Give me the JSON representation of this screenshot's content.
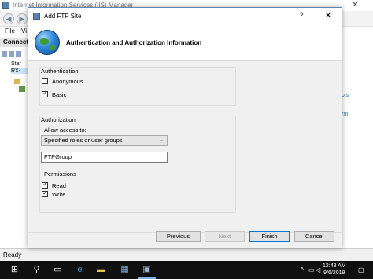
{
  "iis": {
    "title": "Internet Information Services (IIS) Manager",
    "menu": {
      "file": "File",
      "view": "Vi"
    },
    "connections_header": "Connection",
    "tree": {
      "start": "Star",
      "server": "RX-"
    },
    "right_links": {
      "tools": "ols",
      "rm": "rm"
    },
    "status": "Ready",
    "close": "✕"
  },
  "dialog": {
    "title": "Add FTP Site",
    "help": "?",
    "close": "✕",
    "heading": "Authentication and Authorization Information",
    "authentication": {
      "label": "Authentication",
      "anonymous": {
        "label": "Anonymous",
        "checked": false
      },
      "basic": {
        "label": "Basic",
        "checked": true
      }
    },
    "authorization": {
      "label": "Authorization",
      "allow_label": "Allow access to:",
      "allow_value": "Specified roles or user groups",
      "group_value": "FTPGroup",
      "permissions_label": "Permissions",
      "read": {
        "label": "Read",
        "checked": true
      },
      "write": {
        "label": "Write",
        "checked": true
      }
    },
    "buttons": {
      "previous": "Previous",
      "next": "Next",
      "finish": "Finish",
      "cancel": "Cancel"
    }
  },
  "taskbar": {
    "start": "⊞",
    "search": "⚲",
    "time": "12:43 AM",
    "date": "9/6/2019"
  },
  "colors": {
    "accent": "#0078d7",
    "taskbar": "#101010",
    "dialog_bg": "#f0f0f0"
  }
}
